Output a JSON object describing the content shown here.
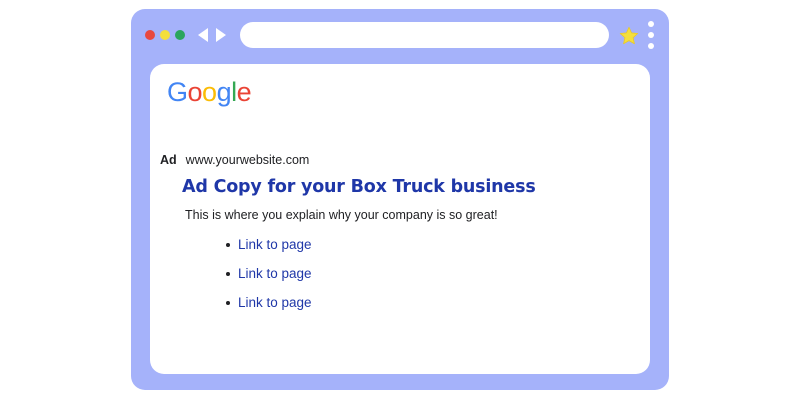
{
  "browser": {
    "address_bar": {
      "value": "",
      "placeholder": ""
    },
    "window_controls": [
      "close-dot",
      "minimize-dot",
      "maximize-dot"
    ],
    "nav_icons": [
      "back-arrow-icon",
      "forward-arrow-icon"
    ],
    "bookmark_icon": "star-icon",
    "menu_icon": "kebab-menu-icon",
    "colors": {
      "frame": "#a5b2fa",
      "close": "#e8483f",
      "minimize": "#f4df3c",
      "maximize": "#2aa55c",
      "star": "#f4df3c"
    }
  },
  "search_page": {
    "logo_text": "Google",
    "logo_letters": [
      {
        "char": "G",
        "color": "#4285f4"
      },
      {
        "char": "o",
        "color": "#ea4335"
      },
      {
        "char": "o",
        "color": "#fbbc05"
      },
      {
        "char": "g",
        "color": "#4285f4"
      },
      {
        "char": "l",
        "color": "#34a853"
      },
      {
        "char": "e",
        "color": "#ea4335"
      }
    ],
    "ad": {
      "label": "Ad",
      "url": "www.yourwebsite.com",
      "title": "Ad Copy for your Box Truck business",
      "description": "This is where you explain why your company is so great!",
      "links": [
        "Link to page",
        "Link to page",
        "Link to page"
      ],
      "link_color": "#1f37a8"
    }
  }
}
